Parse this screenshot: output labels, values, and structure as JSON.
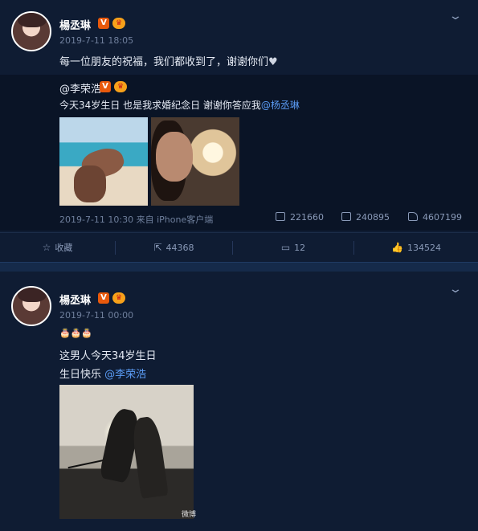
{
  "post1": {
    "username": "楊丞琳",
    "time": "2019-7-11 18:05",
    "text": "每一位朋友的祝福，我们都收到了，谢谢你们",
    "heart": "♥",
    "quoted": {
      "author": "@李荣浩",
      "text_prefix": "今天34岁生日 也是我求婚纪念日 谢谢你答应我",
      "mention": "@杨丞琳",
      "meta": "2019-7-11 10:30 来自 iPhone客户端",
      "reposts": "221660",
      "comments": "240895",
      "likes": "4607199"
    },
    "actions": {
      "favorite": "收藏",
      "repost": "44368",
      "comment": "12",
      "like": "134524"
    }
  },
  "post2": {
    "username": "楊丞琳",
    "time": "2019-7-11 00:00",
    "line1": "🎂🎂🎂",
    "line2": "这男人今天34岁生日",
    "line3_prefix": "生日快乐 ",
    "line3_mention": "@李荣浩",
    "watermark": "微博"
  },
  "badges": {
    "v": "V",
    "crown": "♛"
  },
  "colors": {
    "background": "#0f1c33",
    "accent": "#5b9cf5",
    "badge_v": "#e8590c",
    "badge_crown": "#f7a11a"
  },
  "icons": [
    "chevron-down-icon",
    "star-icon",
    "repost-icon",
    "comment-icon",
    "like-icon",
    "heart-icon"
  ]
}
